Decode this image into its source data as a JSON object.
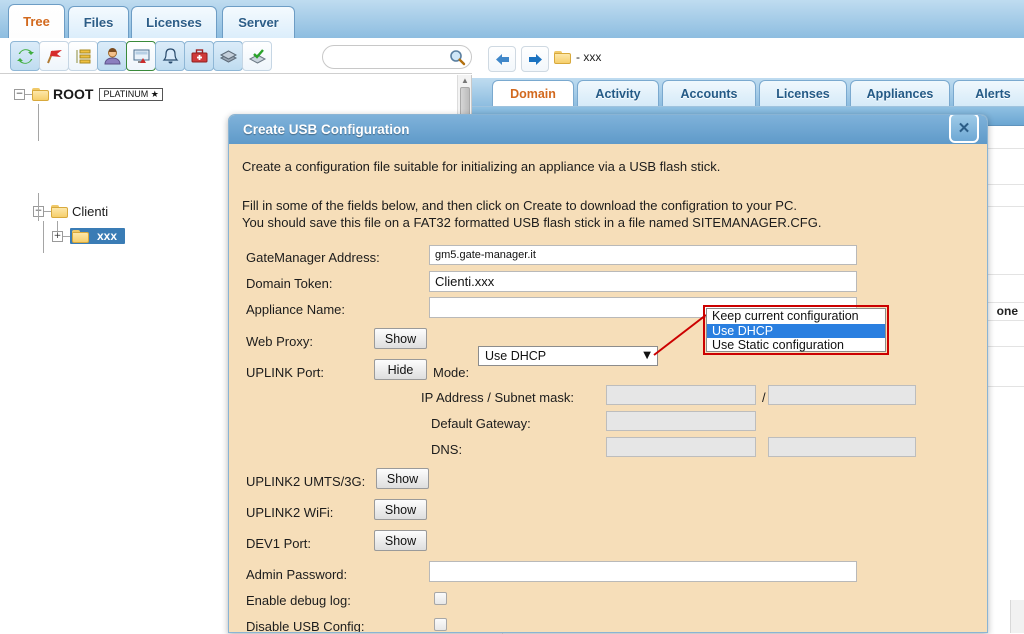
{
  "app": {
    "main_tabs": [
      {
        "label": "Tree",
        "active": true
      },
      {
        "label": "Files",
        "active": false
      },
      {
        "label": "Licenses",
        "active": false
      },
      {
        "label": "Server",
        "active": false
      }
    ],
    "toolbar_icons": [
      "refresh-icon",
      "red-flag-icon",
      "tree-list-icon",
      "user-icon",
      "monitor-icon",
      "alert-bell-icon",
      "briefcase-icon",
      "books-icon",
      "book-check-icon"
    ],
    "search": {
      "value": "",
      "placeholder": ""
    }
  },
  "tree": {
    "nodes": [
      {
        "label": "ROOT",
        "badge": "PLATINUM ★",
        "expander": "−",
        "selected": false
      },
      {
        "label": "Clienti",
        "badge": "",
        "expander": "−",
        "selected": false
      },
      {
        "label": "xxx",
        "badge": "",
        "expander": "+",
        "selected": true
      }
    ]
  },
  "nav": {
    "back_icon": "arrow-left-icon",
    "forward_icon": "arrow-right-icon",
    "breadcrumb": "- xxx",
    "breadcrumb_icon": "folder-icon"
  },
  "content_tabs": [
    {
      "label": "Domain",
      "active": true
    },
    {
      "label": "Activity",
      "active": false
    },
    {
      "label": "Accounts",
      "active": false
    },
    {
      "label": "Licenses",
      "active": false
    },
    {
      "label": "Appliances",
      "active": false
    },
    {
      "label": "Alerts",
      "active": false
    }
  ],
  "background_table": {
    "partial_cell_text": "one"
  },
  "dialog": {
    "title": "Create USB Configuration",
    "close_icon": "close-icon",
    "intro_line1": "Create a configuration file suitable for initializing an appliance via a USB flash stick.",
    "intro_line2": "Fill in some of the fields below, and then click on Create to download the configration to your PC.",
    "intro_line3": "You should save this file on a FAT32 formatted USB flash stick in a file named SITEMANAGER.CFG.",
    "fields": {
      "gatemanager_address": {
        "label": "GateManager Address:",
        "value": "gm5.gate-manager.it",
        "placeholder": ""
      },
      "domain_token": {
        "label": "Domain Token:",
        "value": "Clienti.xxx",
        "placeholder": ""
      },
      "appliance_name": {
        "label": "Appliance Name:",
        "value": "",
        "placeholder": ""
      },
      "web_proxy": {
        "label": "Web Proxy:",
        "button": "Show"
      },
      "uplink_port": {
        "label": "UPLINK Port:",
        "button": "Hide"
      },
      "mode": {
        "label": "Mode:",
        "value": "Use DHCP"
      },
      "ip_subnet": {
        "label": "IP Address / Subnet mask:",
        "ip_value": "",
        "separator": "/",
        "subnet_value": ""
      },
      "default_gateway": {
        "label": "Default Gateway:",
        "value": ""
      },
      "dns": {
        "label": "DNS:",
        "value1": "",
        "value2": ""
      },
      "uplink2_umts": {
        "label": "UPLINK2 UMTS/3G:",
        "button": "Show"
      },
      "uplink2_wifi": {
        "label": "UPLINK2 WiFi:",
        "button": "Show"
      },
      "dev1_port": {
        "label": "DEV1 Port:",
        "button": "Show"
      },
      "admin_password": {
        "label": "Admin Password:",
        "value": "",
        "placeholder": ""
      },
      "enable_debug_log": {
        "label": "Enable debug log:",
        "checked": false
      },
      "disable_usb_config": {
        "label": "Disable USB Config:",
        "checked": false
      }
    },
    "mode_dropdown": {
      "options": [
        {
          "label": "Keep current configuration",
          "selected": false
        },
        {
          "label": "Use DHCP",
          "selected": true
        },
        {
          "label": "Use Static configuration",
          "selected": false
        }
      ]
    }
  },
  "colors": {
    "dialog_body": "#f6deb9",
    "dialog_header": "#6ba6d2",
    "tab_active_text": "#d2691e",
    "tab_text": "#2c5d87",
    "tree_selection": "#3a7cb5",
    "dropdown_highlight": "#2a7fe0",
    "annotation_red": "#cc0000"
  }
}
